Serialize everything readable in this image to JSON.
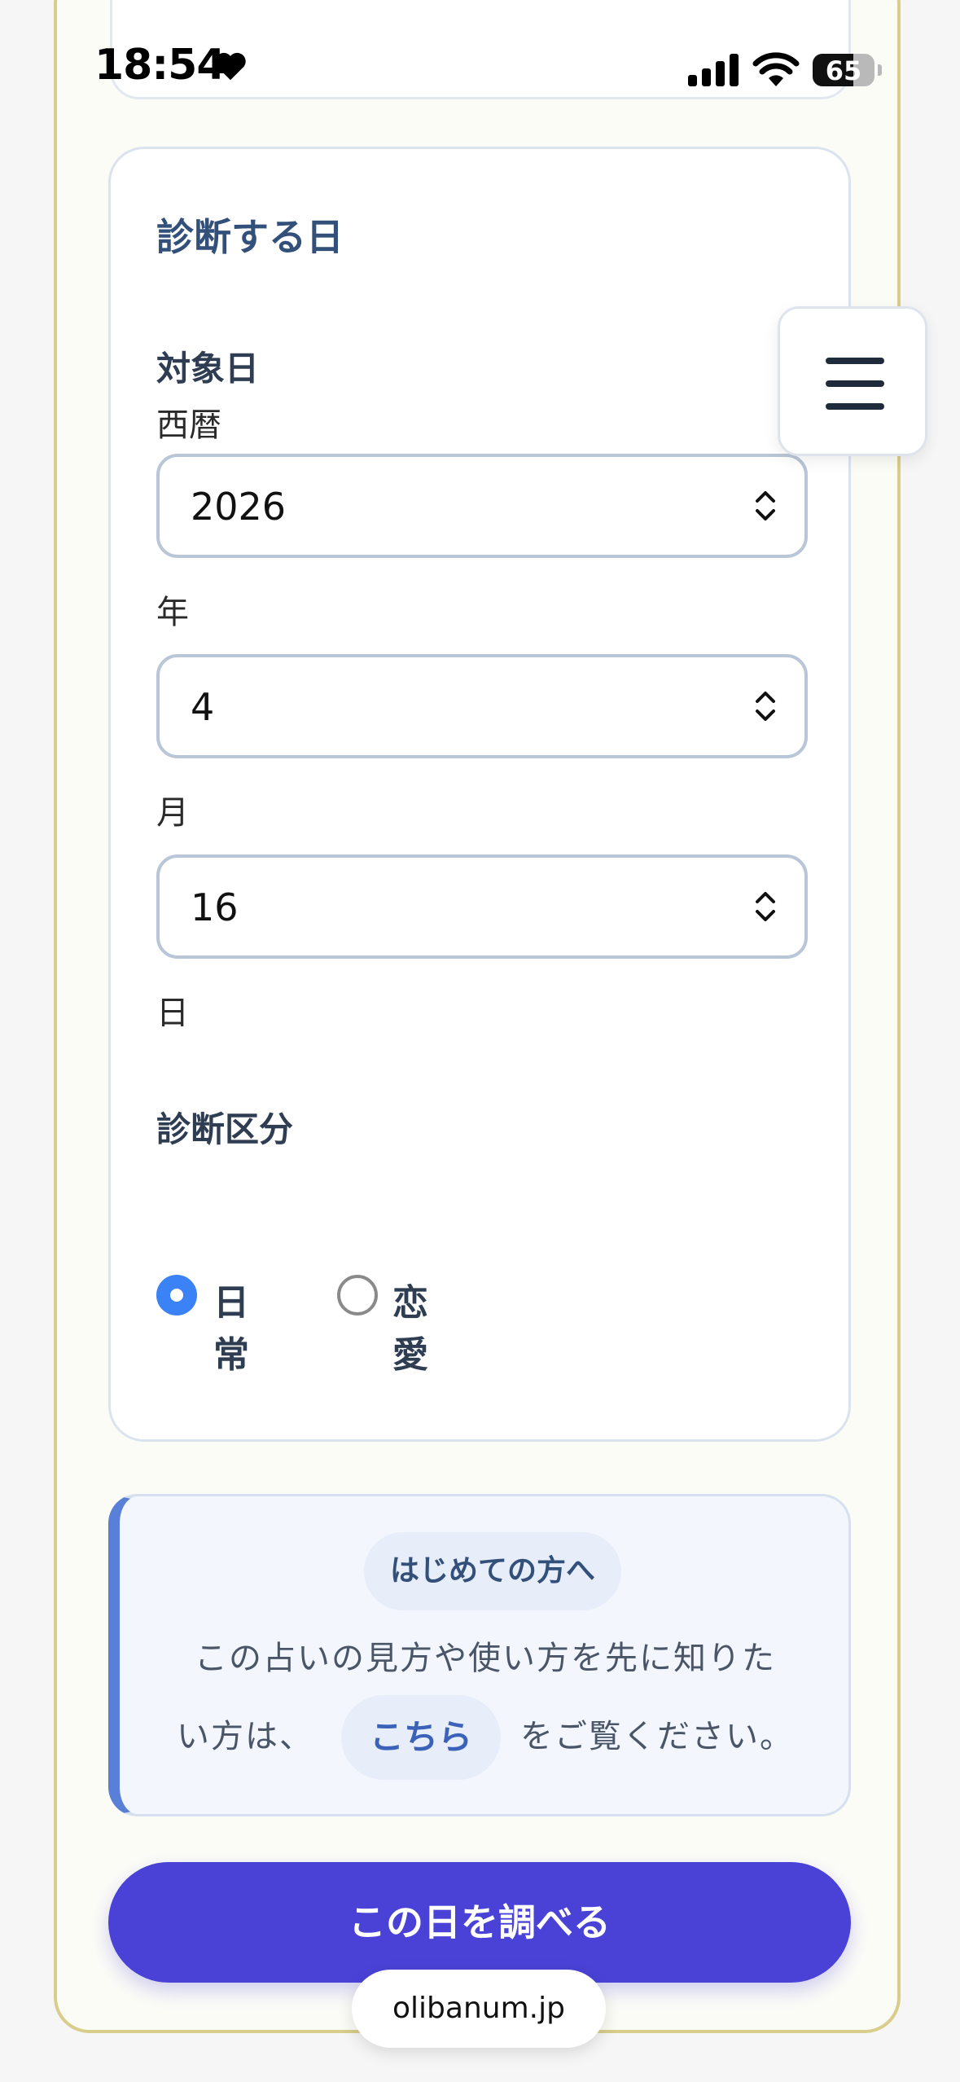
{
  "status_bar": {
    "time": "18:54",
    "battery": "65",
    "icons": [
      "heart-icon",
      "cellular-signal-icon",
      "wifi-icon",
      "battery-icon"
    ]
  },
  "card": {
    "title": "診断する日",
    "target_label": "対象日",
    "era_label": "西暦",
    "year_value": "2026",
    "year_suffix": "年",
    "month_value": "4",
    "month_suffix": "月",
    "day_value": "16",
    "day_suffix": "日",
    "category_label": "診断区分",
    "options": [
      {
        "label": "日常",
        "selected": true
      },
      {
        "label": "恋愛",
        "selected": false
      }
    ]
  },
  "intro": {
    "badge": "はじめての方へ",
    "line1": "この占いの見方や使い方を先に知りた",
    "line2_before": "い方は、",
    "link": "こちら",
    "line2_after": "をご覧ください。"
  },
  "cta_label": "この日を調べる",
  "url": "olibanum.jp",
  "colors": {
    "accent": "#4a42d6",
    "radio_selected": "#3b82f6",
    "title": "#33507a",
    "frame_border": "#d9cd8c"
  }
}
